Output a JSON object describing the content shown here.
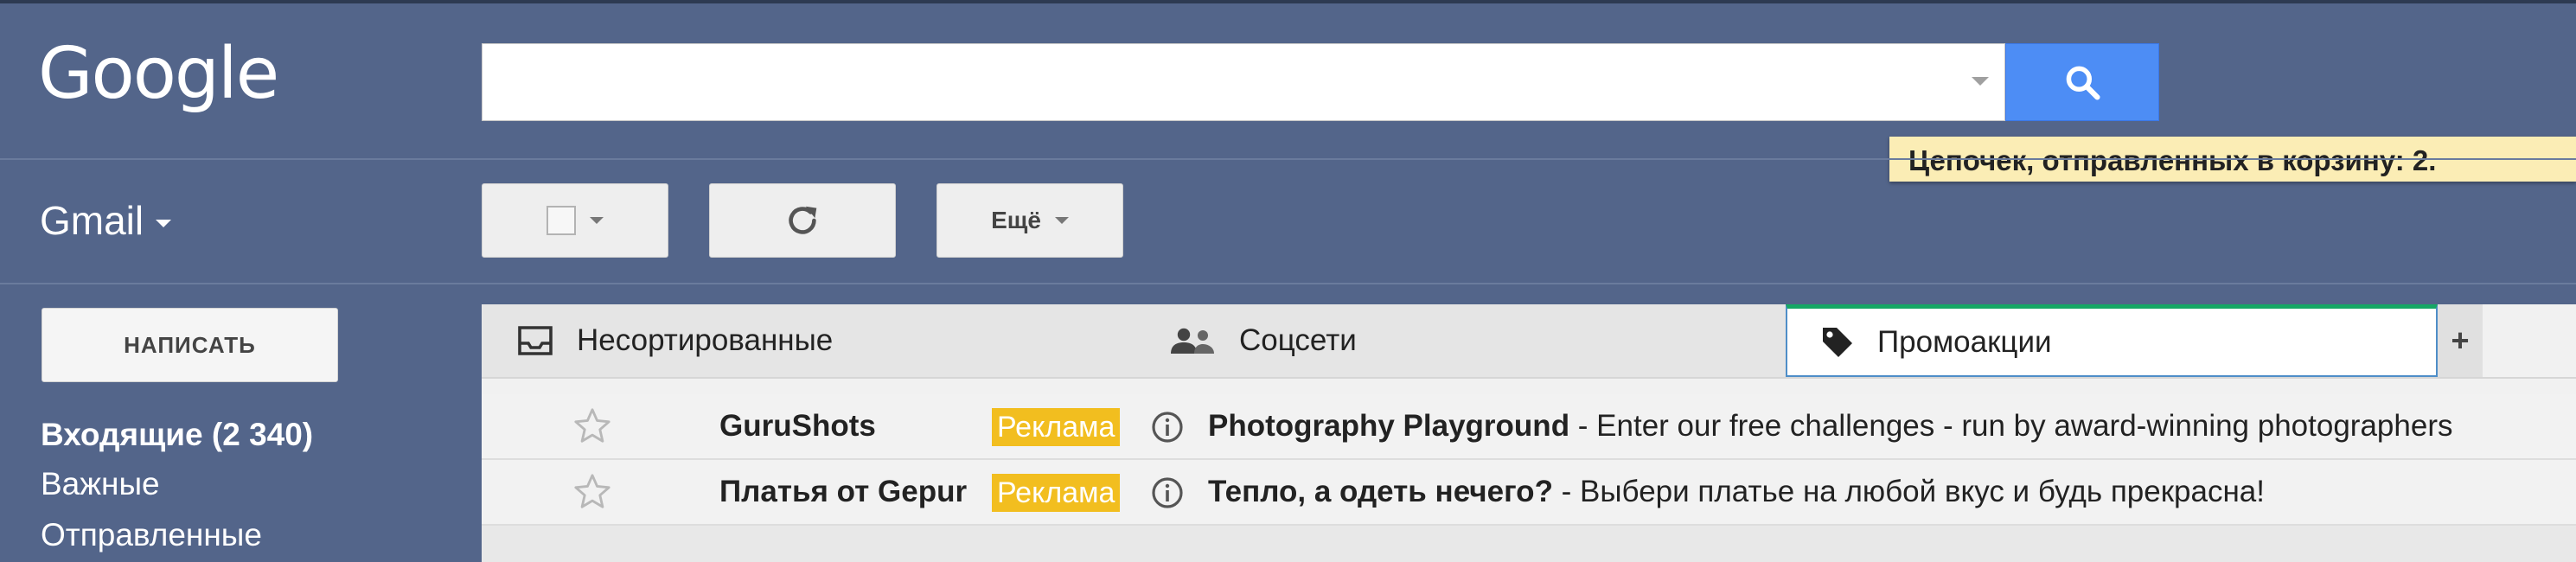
{
  "header": {
    "logo": "Google",
    "search": {
      "value": "",
      "placeholder": ""
    },
    "tooltip": "Цепочек, отправленных в корзину: 2."
  },
  "toolbar": {
    "app_label": "Gmail",
    "more_label": "Ещё"
  },
  "sidebar": {
    "compose_label": "НАПИСАТЬ",
    "items": [
      {
        "label": "Входящие (2 340)",
        "bold": true
      },
      {
        "label": "Важные",
        "bold": false
      },
      {
        "label": "Отправленные",
        "bold": false
      }
    ]
  },
  "tabs": [
    {
      "label": "Несортированные",
      "icon": "inbox-icon",
      "active": false
    },
    {
      "label": "Соцсети",
      "icon": "people-icon",
      "active": false
    },
    {
      "label": "Промоакции",
      "icon": "tag-icon",
      "active": true
    }
  ],
  "add_tab_label": "+",
  "emails": [
    {
      "sender": "GuruShots",
      "badge": "Реклама",
      "subject": "Photography Playground",
      "snippet": " - Enter our free challenges - run by award-winning photographers"
    },
    {
      "sender": "Платья от Gepur",
      "badge": "Реклама",
      "subject": "Тепло, а одеть нечего?",
      "snippet": " - Выбери платье на любой вкус и будь прекрасна!"
    }
  ],
  "colors": {
    "background": "#53658a",
    "search_button": "#4d8df5",
    "ad_badge": "#f2be1f",
    "active_tab_top": "#16a765",
    "tooltip": "#fbedb5"
  }
}
